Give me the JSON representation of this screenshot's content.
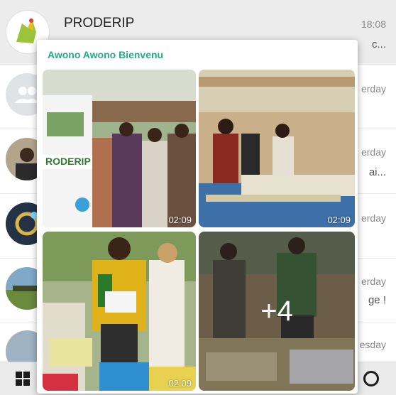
{
  "chat_list": {
    "rows": [
      {
        "name": "PRODERIP",
        "time": "18:08",
        "snippet": "c..."
      },
      {
        "time": "erday"
      },
      {
        "time": "erday",
        "snippet": "ai..."
      },
      {
        "time": "erday"
      },
      {
        "time": "erday",
        "snippet": "ge !"
      },
      {
        "time": "esday"
      }
    ]
  },
  "popup": {
    "sender": "Awono Awono Bienvenu",
    "tiles": [
      {
        "duration": "02:09"
      },
      {
        "duration": "02:09"
      },
      {
        "duration": ""
      },
      {
        "more": "+4"
      }
    ],
    "colors": {
      "sender": "#1fae86"
    }
  },
  "taskbar": {
    "start_icon": "windows-icon",
    "search_icon": "search-circle-icon"
  }
}
